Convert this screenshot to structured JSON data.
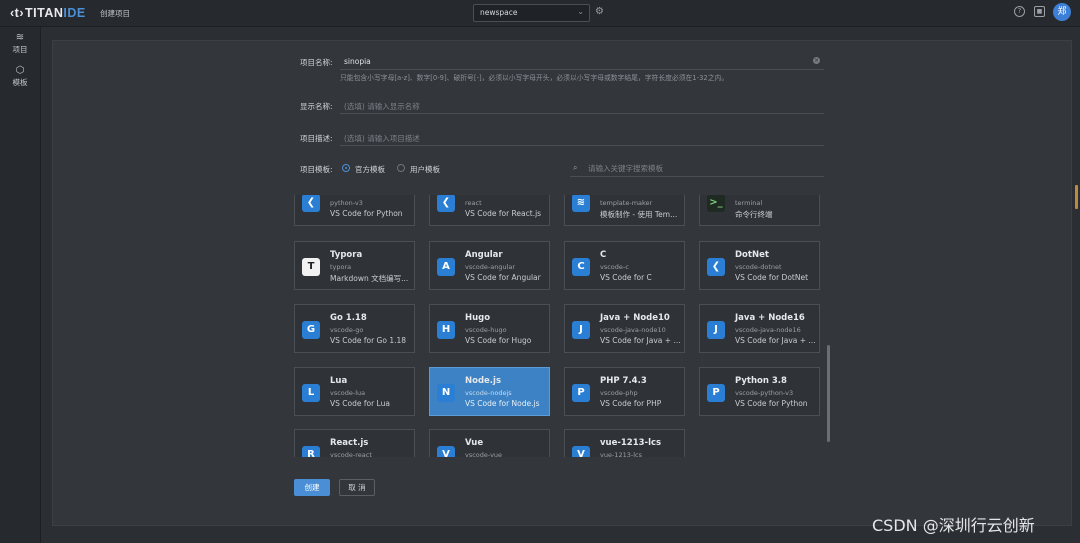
{
  "app": {
    "logo": "TITANIDE",
    "logo_mark": "‹t›",
    "breadcrumb": "创建项目"
  },
  "toolbar": {
    "workspace_value": "newspace",
    "avatar_text": "郑"
  },
  "sidebar": {
    "items": [
      {
        "label": "项目",
        "icon": "layers-icon"
      },
      {
        "label": "模板",
        "icon": "cube-icon"
      }
    ]
  },
  "form": {
    "name_label": "项目名称:",
    "name_value": "sinopia",
    "name_hint": "只能包含小写字母[a-z]、数字[0-9]、破折号[-]，必须以小写字母开头，必须以小写字母或数字结尾，字符长度必须在1-32之内。",
    "display_label": "显示名称:",
    "display_placeholder": "(选填) 请输入显示名称",
    "desc_label": "项目描述:",
    "desc_placeholder": "(选填) 请输入项目描述",
    "template_label": "项目模板:",
    "official_label": "官方模板",
    "user_label": "用户模板",
    "search_placeholder": "请输入关键字搜索模板"
  },
  "templates": [
    {
      "title": "",
      "sub": "python-v3",
      "desc": "VS Code for Python",
      "color": "#2a7fd4",
      "glyph": "❮"
    },
    {
      "title": "",
      "sub": "react",
      "desc": "VS Code for React.js",
      "color": "#2a7fd4",
      "glyph": "❮"
    },
    {
      "title": "",
      "sub": "template-maker",
      "desc": "模板制作 - 使用 Tem...",
      "color": "#2a7fd4",
      "glyph": "≋"
    },
    {
      "title": "",
      "sub": "terminal",
      "desc": "命令行终端",
      "color": "#1e2a22",
      "glyph": ">_"
    },
    {
      "title": "Typora",
      "sub": "typora",
      "desc": "Markdown 文档编写...",
      "color": "#f2f2f2",
      "glyph": "T"
    },
    {
      "title": "Angular",
      "sub": "vscode-angular",
      "desc": "VS Code for Angular",
      "color": "#2a7fd4",
      "glyph": "A"
    },
    {
      "title": "C",
      "sub": "vscode-c",
      "desc": "VS Code for C",
      "color": "#2a7fd4",
      "glyph": "C"
    },
    {
      "title": "DotNet",
      "sub": "vscode-dotnet",
      "desc": "VS Code for DotNet",
      "color": "#2a7fd4",
      "glyph": "❮"
    },
    {
      "title": "Go 1.18",
      "sub": "vscode-go",
      "desc": "VS Code for Go 1.18",
      "color": "#2a7fd4",
      "glyph": "G"
    },
    {
      "title": "Hugo",
      "sub": "vscode-hugo",
      "desc": "VS Code for Hugo",
      "color": "#2a7fd4",
      "glyph": "H"
    },
    {
      "title": "Java + Node10",
      "sub": "vscode-java-node10",
      "desc": "VS Code for Java + ...",
      "color": "#2a7fd4",
      "glyph": "J"
    },
    {
      "title": "Java + Node16",
      "sub": "vscode-java-node16",
      "desc": "VS Code for Java + ...",
      "color": "#2a7fd4",
      "glyph": "J"
    },
    {
      "title": "Lua",
      "sub": "vscode-lua",
      "desc": "VS Code for Lua",
      "color": "#2a7fd4",
      "glyph": "L"
    },
    {
      "title": "Node.js",
      "sub": "vscode-nodejs",
      "desc": "VS Code for Node.js",
      "color": "#2a7fd4",
      "glyph": "N",
      "selected": true
    },
    {
      "title": "PHP 7.4.3",
      "sub": "vscode-php",
      "desc": "VS Code for PHP",
      "color": "#2a7fd4",
      "glyph": "P"
    },
    {
      "title": "Python 3.8",
      "sub": "vscode-python-v3",
      "desc": "VS Code for Python",
      "color": "#2a7fd4",
      "glyph": "P"
    },
    {
      "title": "React.js",
      "sub": "vscode-react",
      "desc": "",
      "color": "#2a7fd4",
      "glyph": "R"
    },
    {
      "title": "Vue",
      "sub": "vscode-vue",
      "desc": "",
      "color": "#2a7fd4",
      "glyph": "V"
    },
    {
      "title": "vue-1213-lcs",
      "sub": "vue-1213-lcs",
      "desc": "",
      "color": "#2a7fd4",
      "glyph": "V"
    }
  ],
  "actions": {
    "create": "创建",
    "cancel": "取 消"
  },
  "watermark": "CSDN @深圳行云创新"
}
